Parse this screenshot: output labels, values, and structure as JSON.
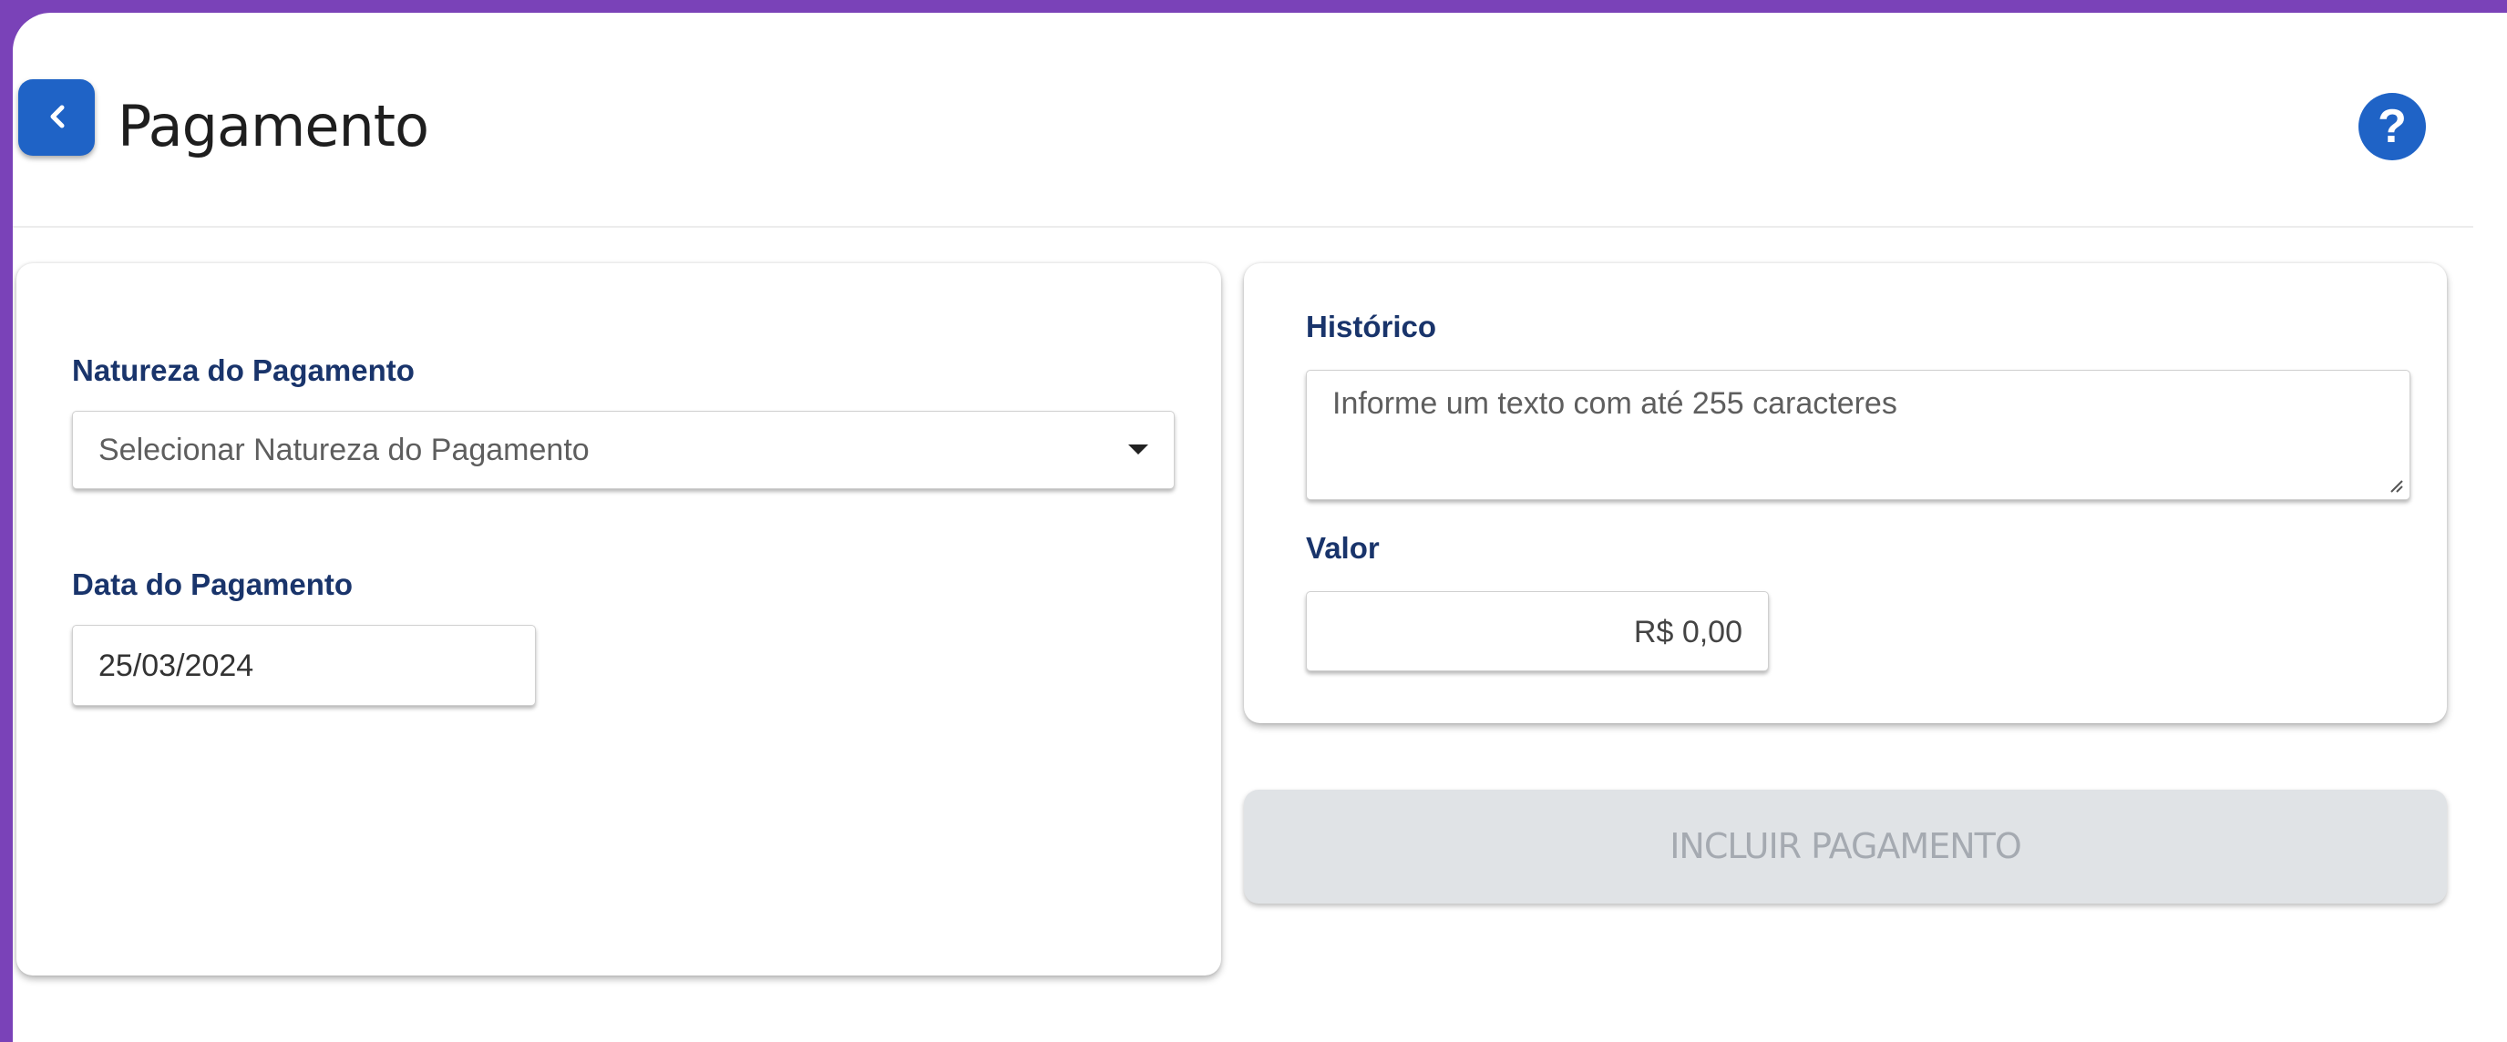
{
  "header": {
    "title": "Pagamento",
    "back_icon": "chevron-left-icon",
    "help_icon": "question-circle-icon",
    "help_glyph": "?"
  },
  "form": {
    "natureza": {
      "label": "Natureza do Pagamento",
      "placeholder": "Selecionar Natureza do Pagamento"
    },
    "data": {
      "label": "Data do Pagamento",
      "value": "25/03/2024"
    },
    "historico": {
      "label": "Histórico",
      "placeholder": "Informe um texto com até 255 caracteres"
    },
    "valor": {
      "label": "Valor",
      "value": "R$ 0,00"
    },
    "submit_label": "INCLUIR PAGAMENTO"
  },
  "colors": {
    "frame": "#7a42b8",
    "accent": "#1f63c6",
    "label": "#19346b",
    "disabled_button": "#e0e3e6",
    "disabled_text": "#a5aab1"
  }
}
